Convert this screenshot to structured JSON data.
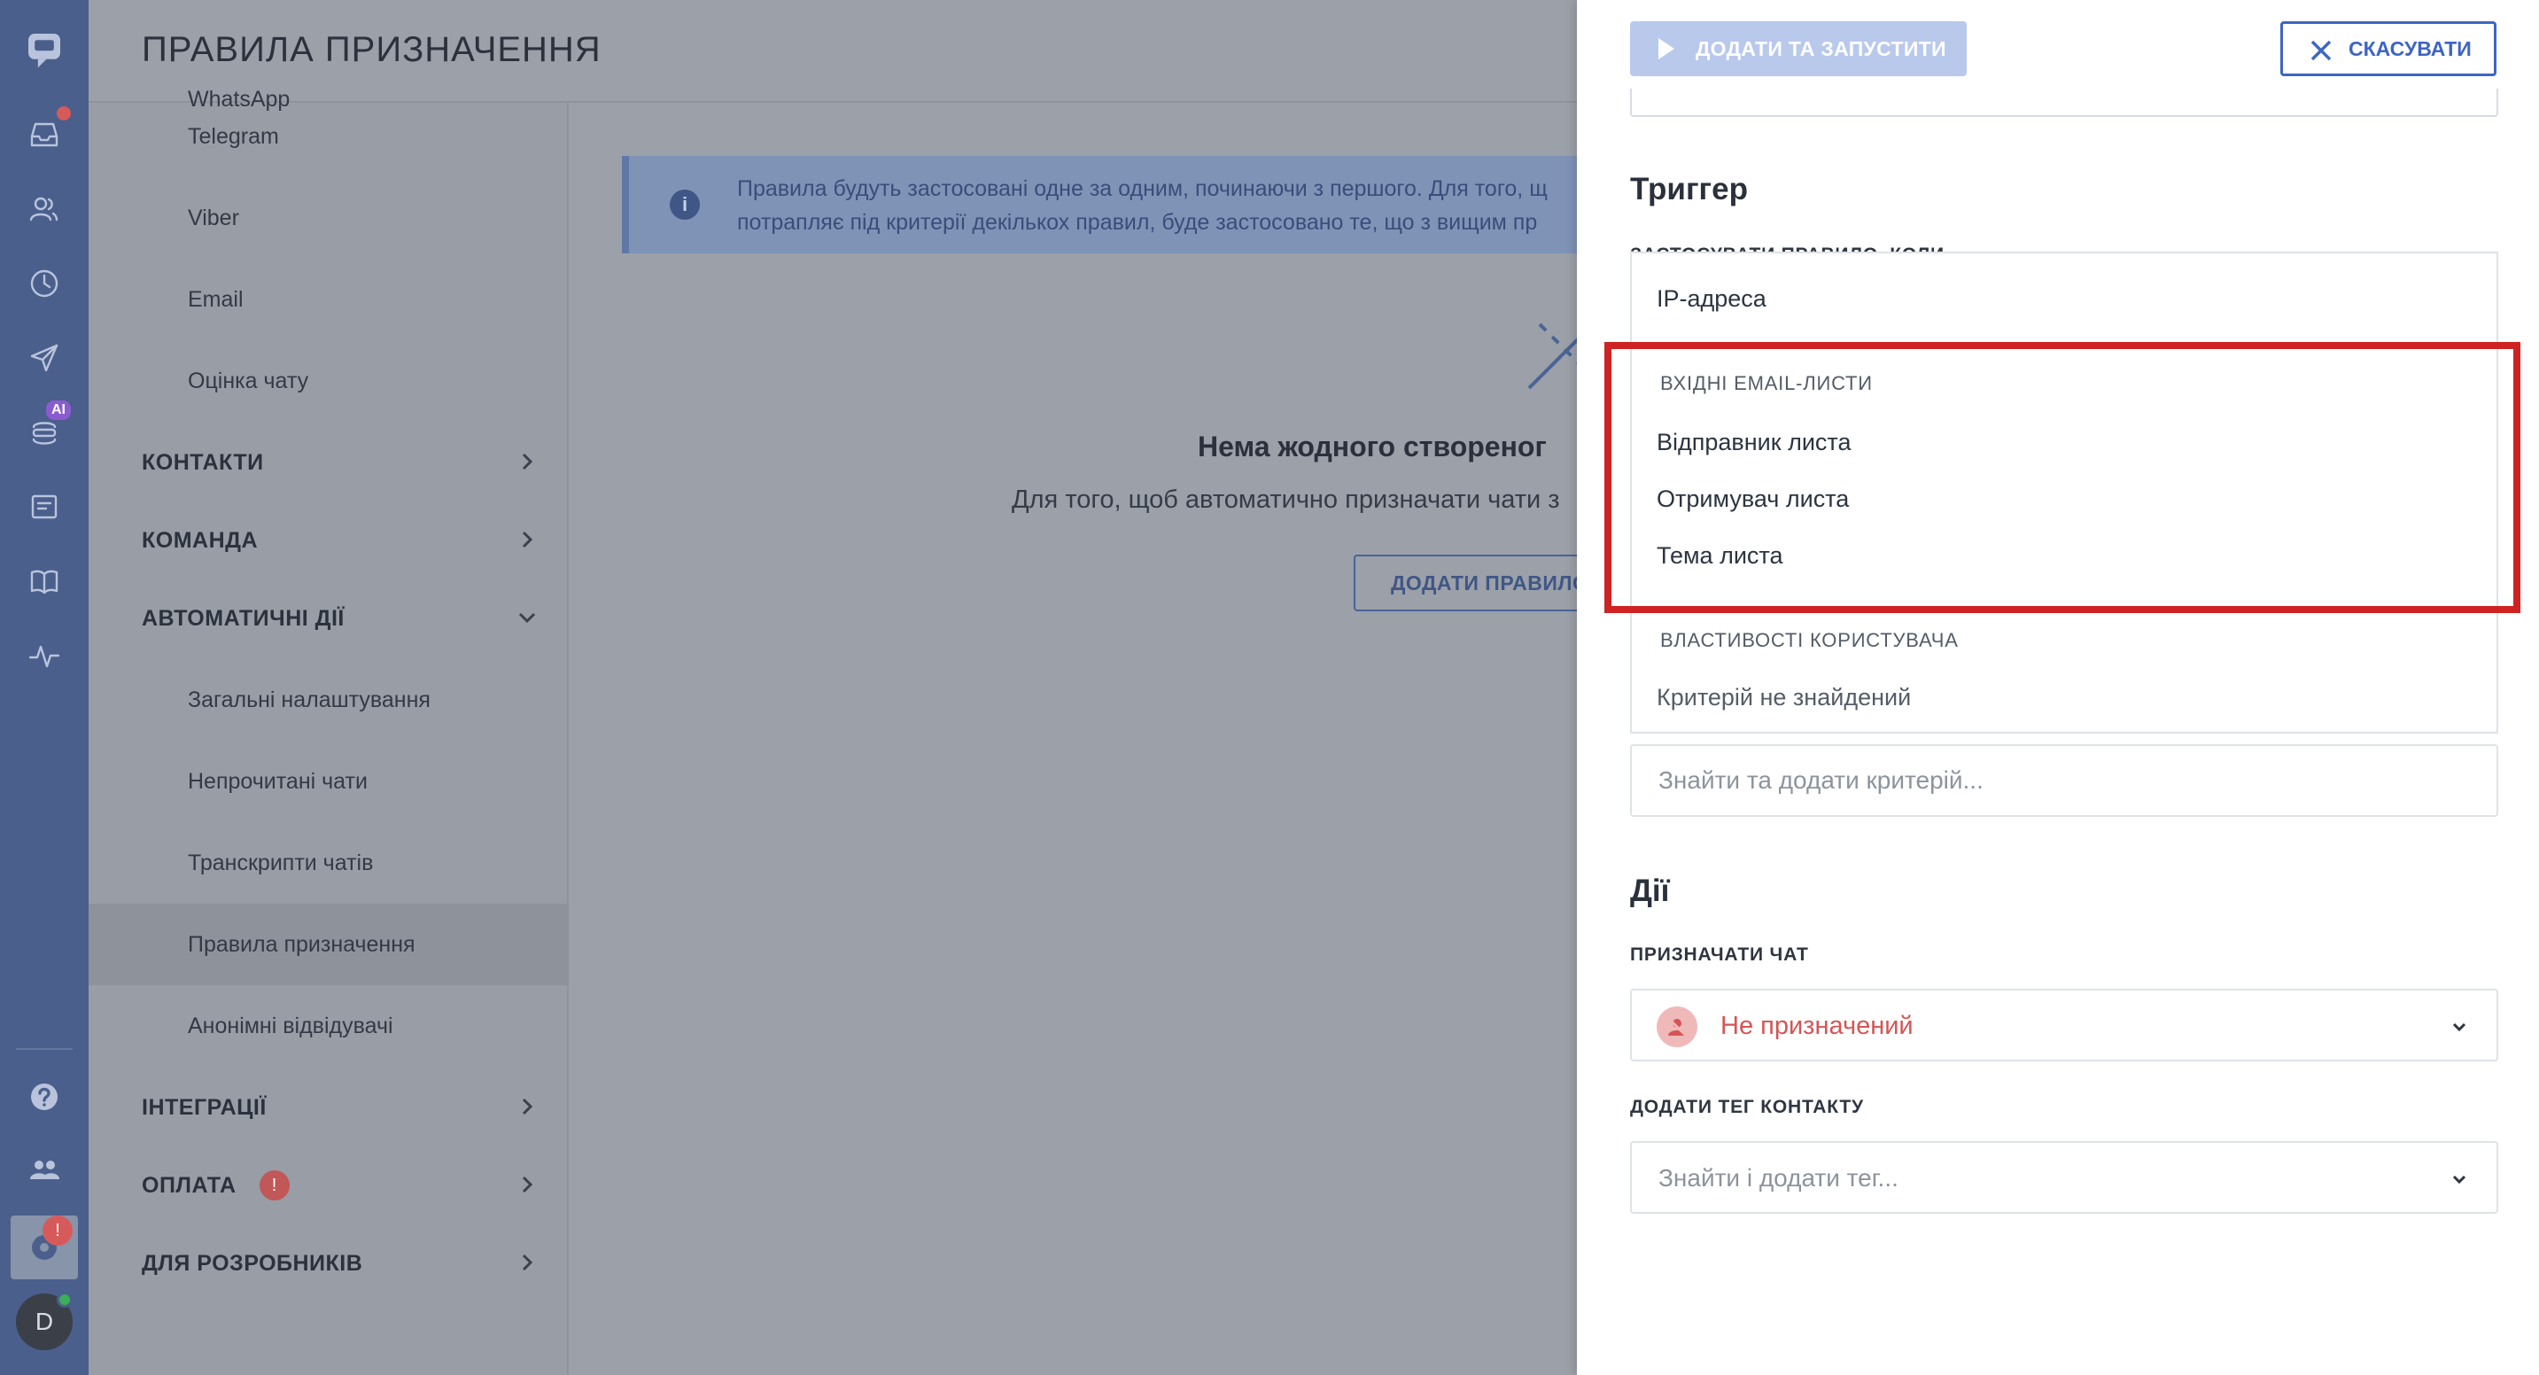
{
  "header": {
    "title": "ПРАВИЛА ПРИЗНАЧЕННЯ"
  },
  "rail": {
    "icons": [
      "chat-logo-icon",
      "inbox-icon",
      "contacts-icon",
      "history-icon",
      "send-icon",
      "ai-bot-icon",
      "widget-icon",
      "knowledge-base-icon",
      "activity-icon",
      "help-icon",
      "team-icon",
      "settings-icon"
    ],
    "ai_badge": "AI",
    "settings_badge": "!",
    "avatar_letter": "D"
  },
  "sidebar": {
    "items": [
      {
        "label": "WhatsApp",
        "kind": "sub"
      },
      {
        "label": "Telegram",
        "kind": "sub"
      },
      {
        "label": "Viber",
        "kind": "sub"
      },
      {
        "label": "Email",
        "kind": "sub"
      },
      {
        "label": "Оцінка чату",
        "kind": "sub"
      },
      {
        "label": "КОНТАКТИ",
        "kind": "section"
      },
      {
        "label": "КОМАНДА",
        "kind": "section"
      },
      {
        "label": "АВТОМАТИЧНІ ДІЇ",
        "kind": "section-open"
      },
      {
        "label": "Загальні налаштування",
        "kind": "sub"
      },
      {
        "label": "Непрочитані чати",
        "kind": "sub"
      },
      {
        "label": "Транскрипти чатів",
        "kind": "sub"
      },
      {
        "label": "Правила призначення",
        "kind": "sub-selected"
      },
      {
        "label": "Анонімні відвідувачі",
        "kind": "sub"
      },
      {
        "label": "ІНТЕГРАЦІЇ",
        "kind": "section"
      },
      {
        "label": "ОПЛАТА",
        "kind": "section"
      },
      {
        "label": "ДЛЯ РОЗРОБНИКІВ",
        "kind": "section"
      }
    ],
    "payment_badge": "!"
  },
  "main": {
    "info_line1": "Правила будуть застосовані одне за одним, починаючи з першого. Для того, щ",
    "info_line2": "потрапляє під критерії декількох правил, буде застосовано те, що з вищим пр",
    "empty_title": "Нема жодного створеног",
    "empty_desc": "Для того, щоб автоматично призначати чати з",
    "add_rule_label": "ДОДАТИ ПРАВИЛО"
  },
  "drawer": {
    "run_label": "ДОДАТИ ТА ЗАПУСТИТИ",
    "cancel_label": "СКАСУВАТИ",
    "trigger_title": "Триггер",
    "trigger_label": "ЗАСТОСУВАТИ ПРАВИЛО, КОЛИ",
    "dropdown": {
      "first_option": "IP-адреса",
      "group1": "ВХІДНІ EMAIL-ЛИСТИ",
      "group1_options": [
        "Відправник листа",
        "Отримувач листа",
        "Тема листа"
      ],
      "group2": "ВЛАСТИВОСТІ КОРИСТУВАЧА",
      "group2_empty": "Критерій не знайдений"
    },
    "criteria_placeholder": "Знайти та додати критерій...",
    "actions_title": "Дії",
    "assign_label": "ПРИЗНАЧАТИ ЧАТ",
    "assign_value": "Не призначений",
    "tag_label": "ДОДАТИ ТЕГ КОНТАКТУ",
    "tag_placeholder": "Знайти і додати тег..."
  }
}
